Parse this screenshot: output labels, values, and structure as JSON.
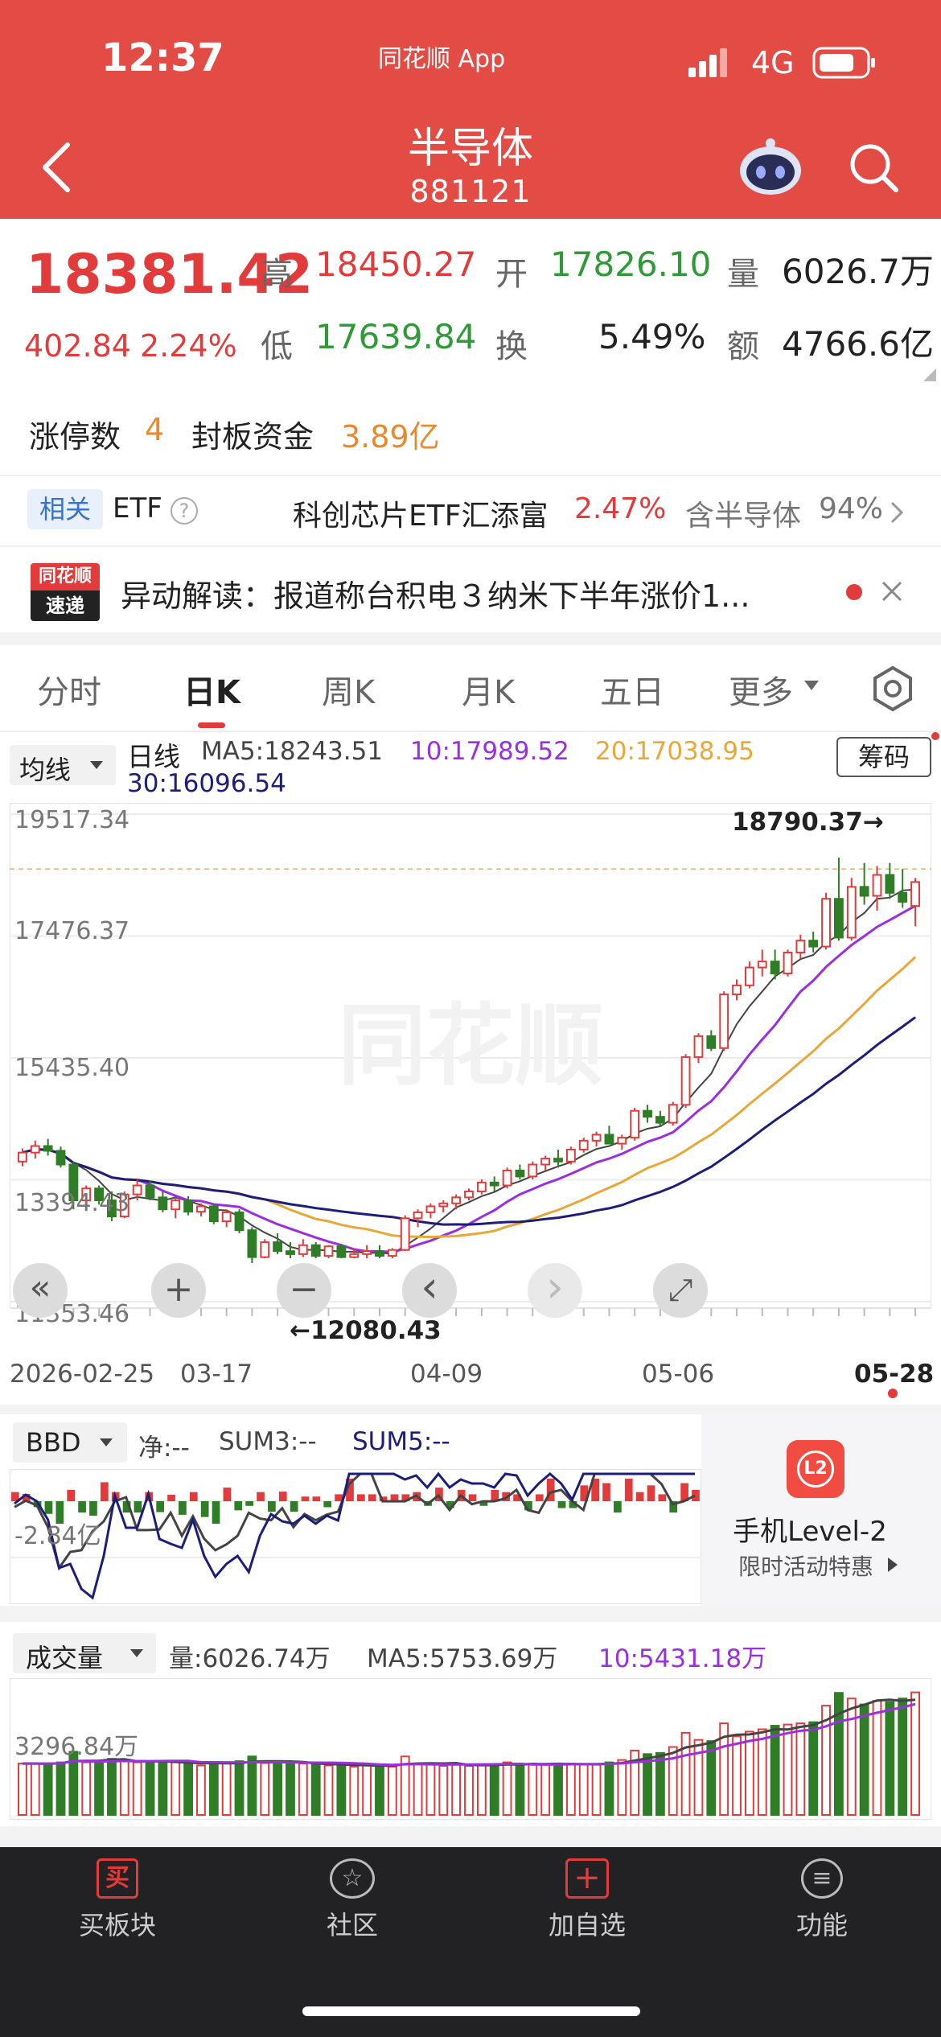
{
  "status_bar": {
    "time": "12:37",
    "app_label": "同花顺 App",
    "network": "4G"
  },
  "header": {
    "title": "半导体",
    "code": "881121"
  },
  "quote": {
    "price": "18381.42",
    "change": "402.84",
    "change_pct": "2.24%",
    "high_label": "高",
    "high": "18450.27",
    "open_label": "开",
    "open": "17826.10",
    "volume_label": "量",
    "volume": "6026.7万",
    "low_label": "低",
    "low": "17639.84",
    "turnover_label": "换",
    "turnover": "5.49%",
    "amount_label": "额",
    "amount": "4766.6亿"
  },
  "limit": {
    "label": "涨停数",
    "count": "4",
    "fund_label": "封板资金",
    "fund": "3.89亿"
  },
  "etf": {
    "badge": "相关",
    "label": "ETF",
    "help": "?",
    "name": "科创芯片ETF汇添富",
    "pct": "2.47%",
    "contains": "含半导体",
    "contains_pct": "94%"
  },
  "news": {
    "logo_top": "同花顺",
    "logo_bottom": "速递",
    "text": "异动解读：报道称台积电３纳米下半年涨价1..."
  },
  "tabs": [
    "分时",
    "日K",
    "周K",
    "月K",
    "五日",
    "更多"
  ],
  "ma": {
    "selector": "均线",
    "period": "日线",
    "ma5": "MA5:18243.51",
    "ma10": "10:17989.52",
    "ma20": "20:17038.95",
    "ma30": "30:16096.54",
    "chip_button": "筹码"
  },
  "colors": {
    "up": "#e23b3b",
    "down": "#2f7d27",
    "ma5": "#444444",
    "ma10": "#9b2fe0",
    "ma20": "#e8a838",
    "ma30": "#1d1d7a",
    "header": "#e34b45"
  },
  "chart_data": [
    {
      "type": "candlestick",
      "y_ticks": [
        "19517.34",
        "17476.37",
        "15435.40",
        "13394.43",
        "11353.46"
      ],
      "x_ticks": [
        "2026-02-25",
        "03-17",
        "04-09",
        "05-06",
        "05-28"
      ],
      "high_annotation": "18790.37→",
      "low_annotation": "←12080.43",
      "ylim": [
        11353.46,
        19517.34
      ],
      "ohlc": [
        [
          13700,
          13920,
          13620,
          13850
        ],
        [
          13850,
          14050,
          13750,
          13960
        ],
        [
          13960,
          14080,
          13800,
          13880
        ],
        [
          13880,
          13950,
          13600,
          13650
        ],
        [
          13650,
          13700,
          12900,
          13050
        ],
        [
          13050,
          13300,
          12950,
          13250
        ],
        [
          13250,
          13300,
          12980,
          13050
        ],
        [
          13050,
          13200,
          12700,
          12780
        ],
        [
          12780,
          13200,
          12750,
          13150
        ],
        [
          13150,
          13400,
          13050,
          13300
        ],
        [
          13300,
          13380,
          13050,
          13100
        ],
        [
          13100,
          13200,
          12850,
          12900
        ],
        [
          12900,
          13100,
          12750,
          13050
        ],
        [
          13050,
          13120,
          12800,
          12860
        ],
        [
          12860,
          13000,
          12780,
          12950
        ],
        [
          12950,
          13000,
          12650,
          12700
        ],
        [
          12700,
          12900,
          12600,
          12850
        ],
        [
          12850,
          12900,
          12500,
          12550
        ],
        [
          12550,
          12600,
          12000,
          12100
        ],
        [
          12100,
          12400,
          12080,
          12350
        ],
        [
          12350,
          12500,
          12150,
          12200
        ],
        [
          12200,
          12350,
          12080,
          12150
        ],
        [
          12150,
          12400,
          12100,
          12300
        ],
        [
          12300,
          12350,
          12080,
          12120
        ],
        [
          12120,
          12300,
          12080,
          12280
        ],
        [
          12280,
          12320,
          12080,
          12100
        ],
        [
          12100,
          12250,
          12080,
          12150
        ],
        [
          12150,
          12300,
          12080,
          12200
        ],
        [
          12200,
          12300,
          12080,
          12120
        ],
        [
          12120,
          12250,
          12080,
          12220
        ],
        [
          12220,
          12800,
          12200,
          12750
        ],
        [
          12750,
          12900,
          12600,
          12850
        ],
        [
          12850,
          13000,
          12750,
          12950
        ],
        [
          12950,
          13050,
          12850,
          13000
        ],
        [
          13000,
          13150,
          12900,
          13100
        ],
        [
          13100,
          13250,
          13050,
          13200
        ],
        [
          13200,
          13400,
          13150,
          13350
        ],
        [
          13350,
          13450,
          13200,
          13300
        ],
        [
          13300,
          13600,
          13250,
          13550
        ],
        [
          13550,
          13650,
          13400,
          13450
        ],
        [
          13450,
          13700,
          13400,
          13650
        ],
        [
          13650,
          13800,
          13550,
          13750
        ],
        [
          13750,
          13900,
          13600,
          13700
        ],
        [
          13700,
          13950,
          13650,
          13900
        ],
        [
          13900,
          14100,
          13850,
          14050
        ],
        [
          14050,
          14200,
          13950,
          14150
        ],
        [
          14150,
          14300,
          14050,
          14000
        ],
        [
          14000,
          14150,
          13900,
          14100
        ],
        [
          14100,
          14600,
          14050,
          14550
        ],
        [
          14550,
          14650,
          14350,
          14450
        ],
        [
          14450,
          14550,
          14300,
          14350
        ],
        [
          14350,
          14700,
          14300,
          14650
        ],
        [
          14650,
          15500,
          14600,
          15450
        ],
        [
          15450,
          15850,
          15350,
          15800
        ],
        [
          15800,
          15900,
          15550,
          15600
        ],
        [
          15600,
          16550,
          15550,
          16500
        ],
        [
          16500,
          16750,
          16400,
          16650
        ],
        [
          16650,
          17050,
          16600,
          16950
        ],
        [
          16950,
          17250,
          16800,
          17050
        ],
        [
          17050,
          17250,
          16750,
          16850
        ],
        [
          16850,
          17250,
          16800,
          17200
        ],
        [
          17200,
          17500,
          17100,
          17400
        ],
        [
          17400,
          17550,
          17200,
          17300
        ],
        [
          17300,
          18200,
          17250,
          18100
        ],
        [
          18100,
          18790,
          17400,
          17450
        ],
        [
          17450,
          18450,
          17400,
          18300
        ],
        [
          18300,
          18700,
          18000,
          18150
        ],
        [
          18150,
          18650,
          17900,
          18500
        ],
        [
          18500,
          18700,
          18100,
          18200
        ],
        [
          18200,
          18600,
          17950,
          18050
        ],
        [
          17980,
          18450,
          17640,
          18381
        ]
      ]
    },
    {
      "type": "bar",
      "name": "BBD",
      "selector": "BBD",
      "net_label": "净:--",
      "sum3_label": "SUM3:--",
      "sum5_label": "SUM5:--",
      "y_tick": "-2.84亿"
    },
    {
      "type": "bar",
      "name": "成交量",
      "selector": "成交量",
      "volume_label": "量:6026.74万",
      "ma5_label": "MA5:5753.69万",
      "ma10_label": "10:5431.18万",
      "y_tick": "3296.84万"
    }
  ],
  "controls": {
    "prev_all": "«",
    "zoom_in": "+",
    "zoom_out": "−",
    "prev": "‹",
    "next": "›",
    "fit": "⤢"
  },
  "ad": {
    "title": "手机Level-2",
    "subtitle": "限时活动特惠",
    "badge": "L2"
  },
  "bottom_nav": [
    {
      "label": "买板块",
      "icon": "买"
    },
    {
      "label": "社区",
      "icon": "☆"
    },
    {
      "label": "加自选",
      "icon": "+"
    },
    {
      "label": "功能",
      "icon": "≡"
    }
  ]
}
